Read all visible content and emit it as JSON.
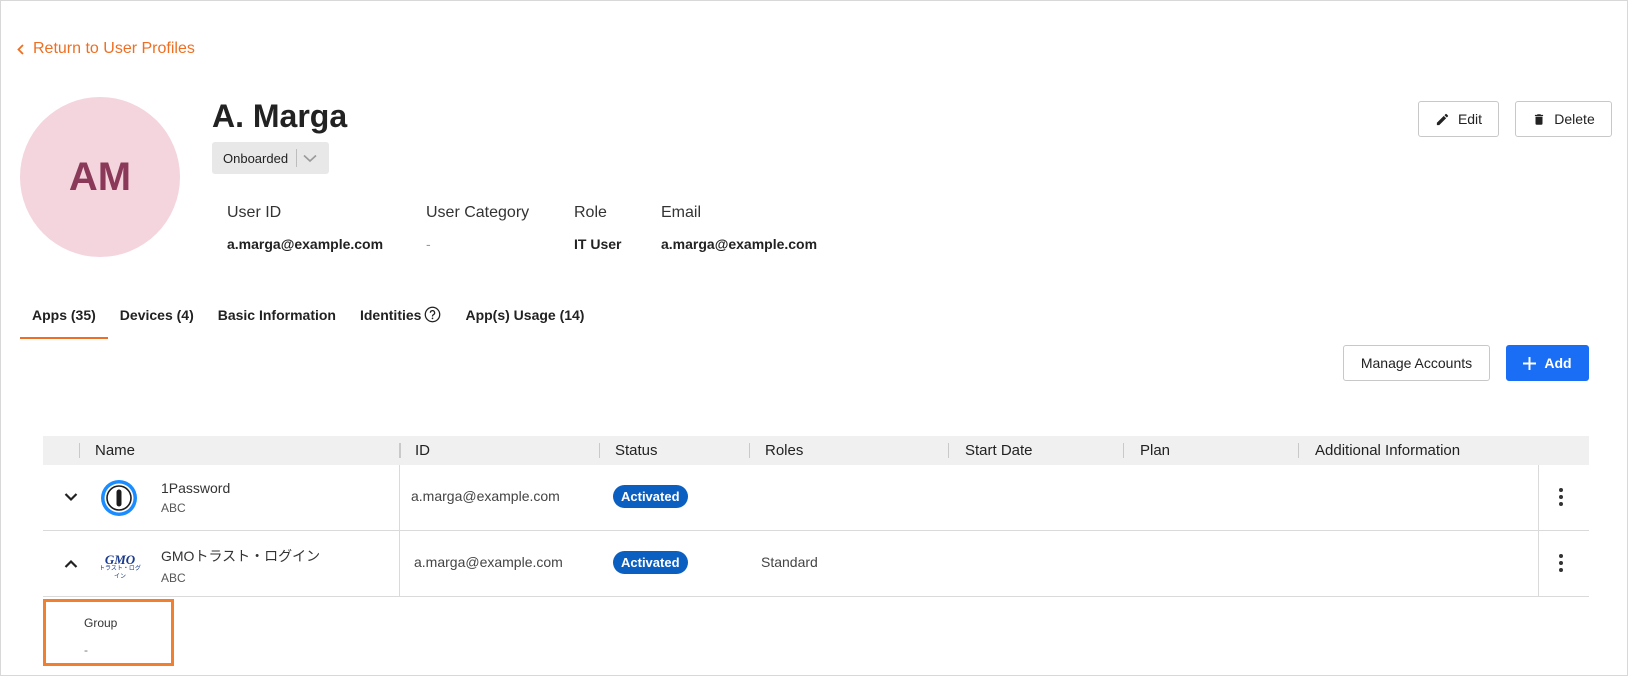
{
  "nav": {
    "back_label": "Return to User Profiles"
  },
  "profile": {
    "initials": "AM",
    "name": "A. Marga",
    "status": "Onboarded",
    "fields": [
      {
        "label": "User ID",
        "value": "a.marga@example.com"
      },
      {
        "label": "User Category",
        "value": "-"
      },
      {
        "label": "Role",
        "value": "IT User"
      },
      {
        "label": "Email",
        "value": "a.marga@example.com"
      }
    ]
  },
  "actions": {
    "edit": "Edit",
    "delete": "Delete",
    "manage": "Manage Accounts",
    "add": "Add"
  },
  "tabs": [
    {
      "label": "Apps (35)",
      "active": true
    },
    {
      "label": "Devices (4)"
    },
    {
      "label": "Basic Information"
    },
    {
      "label": "Identities"
    },
    {
      "label": "App(s) Usage (14)"
    }
  ],
  "table": {
    "columns": [
      "Name",
      "ID",
      "Status",
      "Roles",
      "Start Date",
      "Plan",
      "Additional Information"
    ],
    "rows": [
      {
        "name": "1Password",
        "org": "ABC",
        "id": "a.marga@example.com",
        "status": "Activated",
        "roles": "",
        "icon": "1password-logo"
      },
      {
        "name": "GMOトラスト・ログイン",
        "org": "ABC",
        "id": "a.marga@example.com",
        "status": "Activated",
        "roles": "Standard",
        "icon": "gmo-logo",
        "logo_text": "GMO",
        "logo_subtext": "トラスト・ログイン"
      }
    ],
    "expanded": {
      "label": "Group",
      "value": "-"
    }
  },
  "colors": {
    "accent": "#ee6f23",
    "primary": "#1a6ef5",
    "badge": "#0b5fc1",
    "avatar_bg": "#f4d4dd"
  }
}
